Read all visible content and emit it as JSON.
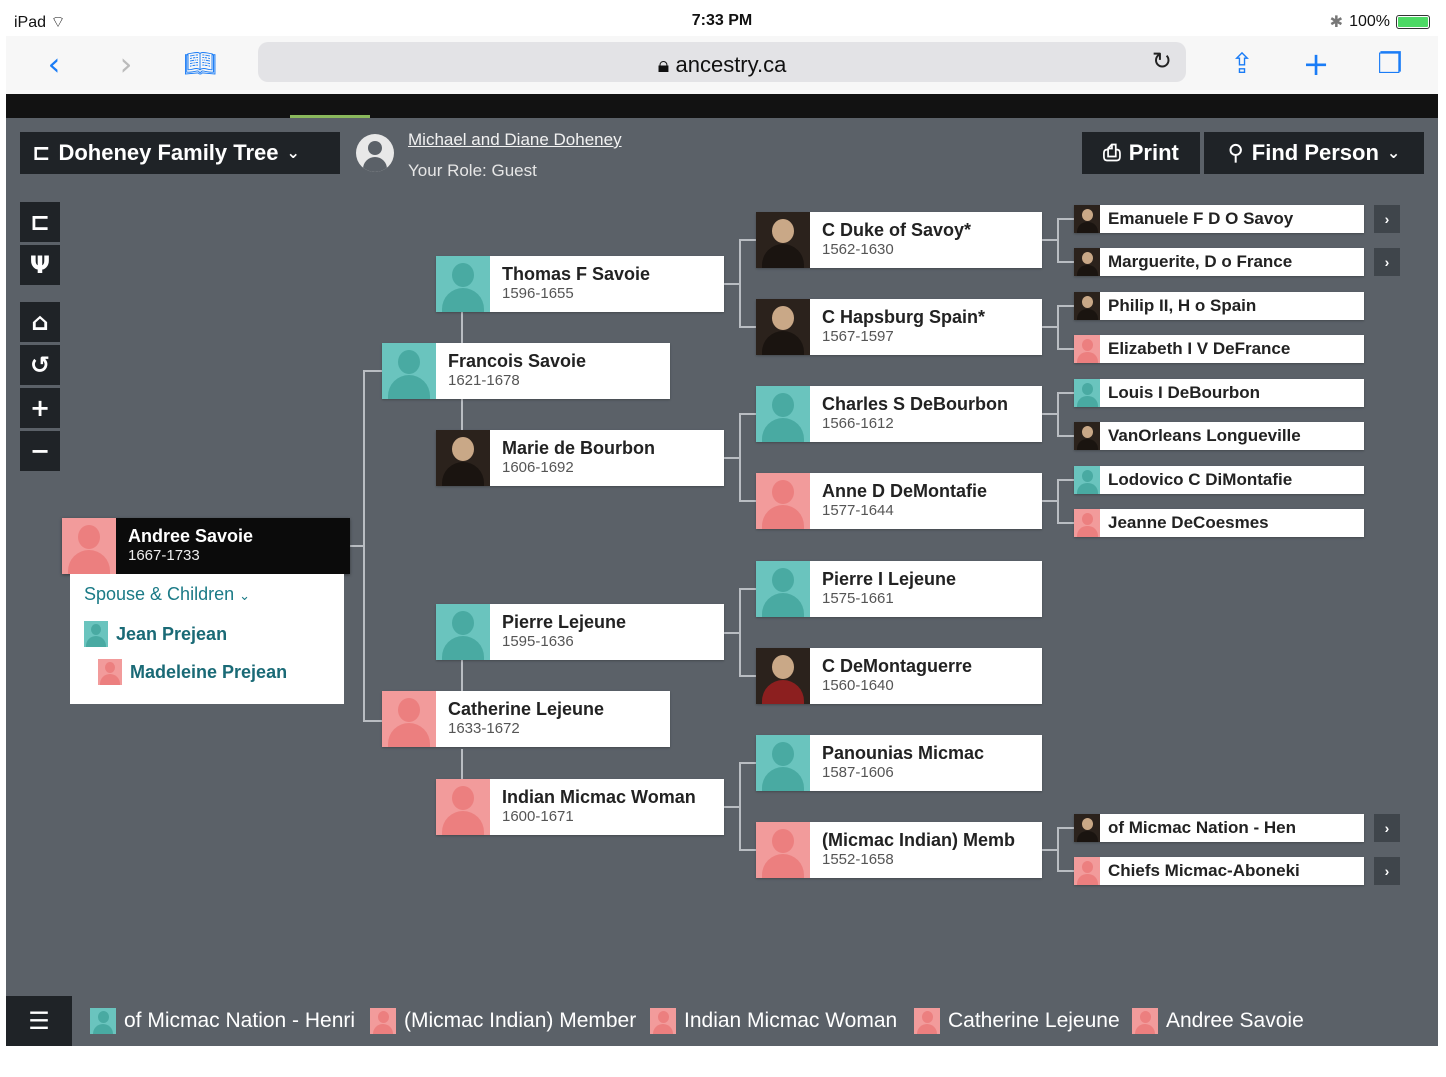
{
  "device": {
    "carrier": "iPad",
    "time": "7:33 PM",
    "battery": "100%"
  },
  "browser": {
    "url": "ancestry.ca",
    "back_icon": "chevron-left-icon",
    "forward_icon": "chevron-right-icon",
    "bookmarks_icon": "book-icon",
    "reload_icon": "reload-icon",
    "share_icon": "share-icon",
    "new_tab_icon": "plus-icon",
    "tabs_icon": "tabs-icon"
  },
  "header": {
    "tree_name": "Doheney Family Tree",
    "owner_name": "Michael and Diane Doheney",
    "role": "Your Role: Guest",
    "print_label": "Print",
    "find_person_label": "Find Person"
  },
  "tools": [
    {
      "name": "pedigree-view-button",
      "glyph": "⊏"
    },
    {
      "name": "family-view-button",
      "glyph": "Ψ"
    },
    {
      "name": "home-button",
      "glyph": "⌂"
    },
    {
      "name": "reset-button",
      "glyph": "↺"
    },
    {
      "name": "zoom-in-button",
      "glyph": "+"
    },
    {
      "name": "zoom-out-button",
      "glyph": "−"
    }
  ],
  "focus": {
    "name": "Andree Savoie",
    "dates": "1667-1733",
    "spouse_children_label": "Spouse & Children",
    "children": [
      {
        "name": "Jean Prejean",
        "gender": "male"
      },
      {
        "name": "Madeleine Prejean",
        "gender": "female"
      }
    ]
  },
  "parents": [
    {
      "name": "Francois Savoie",
      "dates": "1621-1678",
      "gender": "male"
    },
    {
      "name": "Catherine Lejeune",
      "dates": "1633-1672",
      "gender": "female"
    }
  ],
  "grandparents": [
    {
      "name": "Thomas F Savoie",
      "dates": "1596-1655",
      "gender": "male"
    },
    {
      "name": "Marie de Bourbon",
      "dates": "1606-1692",
      "gender": "portrait"
    },
    {
      "name": "Pierre Lejeune",
      "dates": "1595-1636",
      "gender": "male"
    },
    {
      "name": "Indian Micmac Woman",
      "dates": "1600-1671",
      "gender": "female"
    }
  ],
  "great_grandparents": [
    {
      "name": "C Duke of Savoy*",
      "dates": "1562-1630",
      "gender": "portrait"
    },
    {
      "name": "C Hapsburg Spain*",
      "dates": "1567-1597",
      "gender": "portrait"
    },
    {
      "name": "Charles S DeBourbon",
      "dates": "1566-1612",
      "gender": "male"
    },
    {
      "name": "Anne D DeMontafie",
      "dates": "1577-1644",
      "gender": "female"
    },
    {
      "name": "Pierre I Lejeune",
      "dates": "1575-1661",
      "gender": "male"
    },
    {
      "name": "C DeMontaguerre",
      "dates": "1560-1640",
      "gender": "portrait-red"
    },
    {
      "name": "Panounias Micmac",
      "dates": "1587-1606",
      "gender": "male"
    },
    {
      "name": "(Micmac Indian) Memb",
      "dates": "1552-1658",
      "gender": "female"
    }
  ],
  "great_great_grandparents": [
    {
      "name": "Emanuele F D O Savoy",
      "gender": "portrait",
      "expand": true
    },
    {
      "name": "Marguerite, D o France",
      "gender": "portrait",
      "expand": true
    },
    {
      "name": "Philip II, H o Spain",
      "gender": "portrait",
      "expand": false
    },
    {
      "name": "Elizabeth I V DeFrance",
      "gender": "female",
      "expand": false
    },
    {
      "name": "Louis I DeBourbon",
      "gender": "male",
      "expand": false
    },
    {
      "name": "VanOrleans Longueville",
      "gender": "portrait",
      "expand": false
    },
    {
      "name": "Lodovico C DiMontafie",
      "gender": "male",
      "expand": false
    },
    {
      "name": "Jeanne DeCoesmes",
      "gender": "female",
      "expand": false
    },
    {
      "name": "of Micmac Nation - Hen",
      "gender": "portrait",
      "expand": true
    },
    {
      "name": "Chiefs Micmac-Aboneki",
      "gender": "female",
      "expand": true
    }
  ],
  "breadcrumb": [
    {
      "name": "of Micmac Nation - Henri",
      "gender": "male"
    },
    {
      "name": "(Micmac Indian) Member",
      "gender": "female"
    },
    {
      "name": "Indian Micmac Woman",
      "gender": "female"
    },
    {
      "name": "Catherine Lejeune",
      "gender": "female"
    },
    {
      "name": "Andree Savoie",
      "gender": "female"
    }
  ],
  "colors": {
    "background": "#5b6168",
    "male": "#6ac4be",
    "female": "#f29b9b",
    "dark": "#1f2327",
    "link": "#1a7a86"
  }
}
